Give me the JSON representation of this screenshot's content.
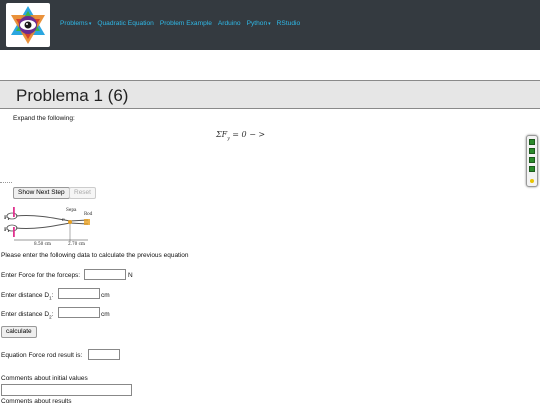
{
  "nav": {
    "items": [
      {
        "label": "Problems",
        "has_caret": true
      },
      {
        "label": "Quadratic Equation",
        "has_caret": false
      },
      {
        "label": "Problem Example",
        "has_caret": false
      },
      {
        "label": "Arduino",
        "has_caret": false
      },
      {
        "label": "Python",
        "has_caret": true
      },
      {
        "label": "RStudio",
        "has_caret": false
      }
    ],
    "caret": "▾"
  },
  "page": {
    "title": "Problema 1 (6)",
    "subtitle": "Expand the following:",
    "equation": "ΣF",
    "equation_sub": "y",
    "equation_rest": " = 0 − >"
  },
  "buttons": {
    "show_next_step": "Show Next Step",
    "reset": "Reset",
    "calculate": "calculate"
  },
  "diagram": {
    "label_sepa": "Sepa",
    "label_rod": "Rod",
    "label_f1": "F",
    "label_f1_sub": "1",
    "label_f2": "F",
    "label_f2_sub": "1",
    "label_p": "P",
    "dim_1": "8.50 cm",
    "dim_2": "2.70 cm"
  },
  "form": {
    "instructions": "Please enter the following data to calculate the previous equation",
    "force_label": "Enter Force for the forceps:",
    "force_value": "",
    "force_unit": "N",
    "d1_label": "Enter distance D",
    "d1_sub": "1",
    "d1_colon": ":",
    "d1_value": "",
    "d1_unit": "cm",
    "d2_label": "Enter distance D",
    "d2_sub": "2",
    "d2_colon": ":",
    "d2_value": "",
    "d2_unit": "cm",
    "result_label": "Equation Force rod result is:",
    "result_value": "",
    "comments_initial_label": "Comments about initial values",
    "comments_initial_value": "",
    "comments_results_label": "Comments about results"
  },
  "colors": {
    "navbar_bg": "#343a40",
    "nav_link": "#2fb9e8",
    "title_bar_bg": "#e6e6e6",
    "widget_green": "#2b8a2b"
  },
  "icons": {
    "logo": "eye-hexagram-logo",
    "side_widget": "green-squares-widget"
  }
}
